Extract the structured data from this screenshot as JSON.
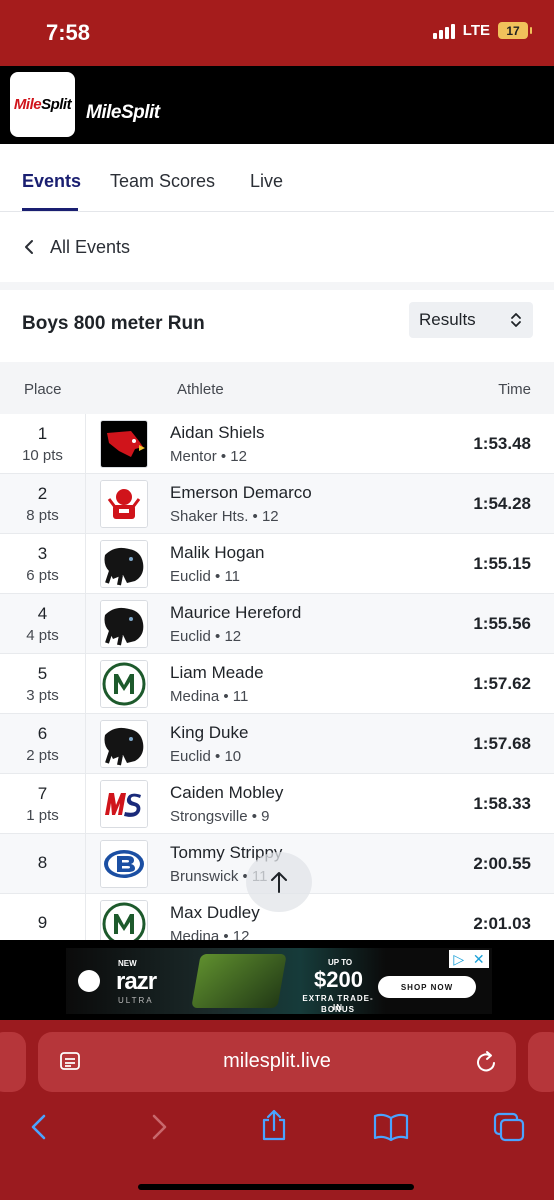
{
  "status": {
    "time": "7:58",
    "network": "LTE",
    "battery": "17"
  },
  "header": {
    "logo_text_a": "Mile",
    "logo_text_b": "Split",
    "app_name": "MileSplit"
  },
  "tabs": [
    {
      "label": "Events",
      "active": true
    },
    {
      "label": "Team Scores"
    },
    {
      "label": "Live"
    }
  ],
  "back": {
    "label": "All Events"
  },
  "event": {
    "title": "Boys 800 meter Run",
    "view_select": "Results"
  },
  "table": {
    "headers": {
      "place": "Place",
      "athlete": "Athlete",
      "time": "Time"
    },
    "rows": [
      {
        "place": "1",
        "points": "10 pts",
        "name": "Aidan Shiels",
        "team": "Mentor • 12",
        "time": "1:53.48",
        "logo": "cardinal-logo"
      },
      {
        "place": "2",
        "points": "8 pts",
        "name": "Emerson Demarco",
        "team": "Shaker Hts. • 12",
        "time": "1:54.28",
        "logo": "raider-logo"
      },
      {
        "place": "3",
        "points": "6 pts",
        "name": "Malik Hogan",
        "team": "Euclid • 11",
        "time": "1:55.15",
        "logo": "panther-logo"
      },
      {
        "place": "4",
        "points": "4 pts",
        "name": "Maurice Hereford",
        "team": "Euclid • 12",
        "time": "1:55.56",
        "logo": "panther-logo"
      },
      {
        "place": "5",
        "points": "3 pts",
        "name": "Liam Meade",
        "team": "Medina • 11",
        "time": "1:57.62",
        "logo": "medina-m-logo"
      },
      {
        "place": "6",
        "points": "2 pts",
        "name": "King Duke",
        "team": "Euclid • 10",
        "time": "1:57.68",
        "logo": "panther-logo"
      },
      {
        "place": "7",
        "points": "1 pts",
        "name": "Caiden Mobley",
        "team": "Strongsville • 9",
        "time": "1:58.33",
        "logo": "ms-logo"
      },
      {
        "place": "8",
        "points": "",
        "name": "Tommy Strippy",
        "team": "Brunswick • 11",
        "time": "2:00.55",
        "logo": "brunswick-b-logo"
      },
      {
        "place": "9",
        "points": "",
        "name": "Max Dudley",
        "team": "Medina • 12",
        "time": "2:01.03",
        "logo": "medina-m-logo"
      }
    ]
  },
  "ad": {
    "brand_new": "NEW",
    "product": "razr",
    "product_sub": "ULTRA",
    "up_to": "UP TO",
    "price": "$200",
    "offer_line1": "EXTRA TRADE-IN",
    "offer_line2": "BONUS",
    "cta": "SHOP NOW"
  },
  "browser": {
    "url": "milesplit.live"
  },
  "colors": {
    "status_bar": "#a51c1c",
    "brand_red": "#d0141b",
    "tab_active": "#1a1f71",
    "browser_bar": "#9b1b1f"
  }
}
